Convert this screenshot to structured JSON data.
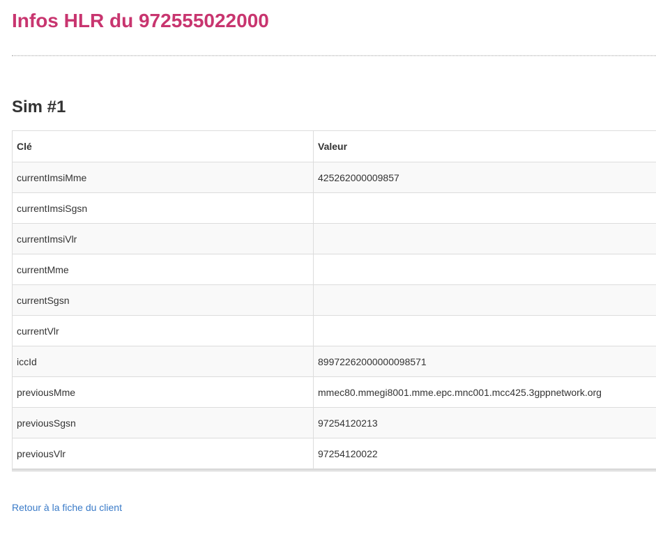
{
  "page": {
    "title": "Infos HLR du 972555022000"
  },
  "section": {
    "title": "Sim #1"
  },
  "table": {
    "headers": [
      "Clé",
      "Valeur"
    ],
    "rows": [
      {
        "key": "currentImsiMme",
        "value": "425262000009857"
      },
      {
        "key": "currentImsiSgsn",
        "value": ""
      },
      {
        "key": "currentImsiVlr",
        "value": ""
      },
      {
        "key": "currentMme",
        "value": ""
      },
      {
        "key": "currentSgsn",
        "value": ""
      },
      {
        "key": "currentVlr",
        "value": ""
      },
      {
        "key": "iccId",
        "value": "89972262000000098571"
      },
      {
        "key": "previousMme",
        "value": "mmec80.mmegi8001.mme.epc.mnc001.mcc425.3gppnetwork.org"
      },
      {
        "key": "previousSgsn",
        "value": "97254120213"
      },
      {
        "key": "previousVlr",
        "value": "97254120022"
      }
    ]
  },
  "footer": {
    "back_link": "Retour à la fiche du client"
  },
  "colors": {
    "title": "#c8356f",
    "link": "#3a7bc8",
    "row_stripe": "#f9f9f9",
    "border": "#dcdcdc"
  }
}
